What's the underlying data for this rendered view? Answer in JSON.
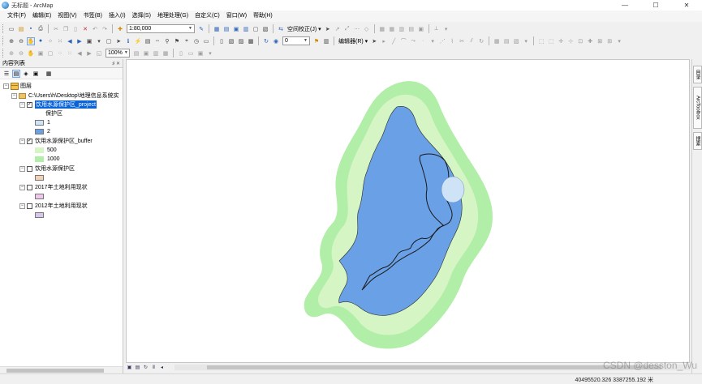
{
  "window": {
    "title": "无标题 - ArcMap",
    "minimize": "—",
    "maximize": "☐",
    "close": "✕"
  },
  "menu": [
    "文件(F)",
    "编辑(E)",
    "视图(V)",
    "书签(B)",
    "插入(I)",
    "选择(S)",
    "地理处理(G)",
    "自定义(C)",
    "窗口(W)",
    "帮助(H)"
  ],
  "toolbar": {
    "scale_value": "1:80,000",
    "georef_label": "空间校正(J) ▾",
    "editor_label": "编辑器(R) ▾",
    "angle_value": "0",
    "zoom_percent": "100%"
  },
  "toc": {
    "title": "内容列表",
    "pin": "♯ ✕",
    "root": "图层",
    "folder": "C:\\Users\\h\\Desktop\\地理信息系统实",
    "layers": [
      {
        "name": "饮用水源保护区_project",
        "checked": true,
        "selected": true,
        "field": "保护区",
        "classes": [
          {
            "label": "1",
            "color": "#cfe3f7"
          },
          {
            "label": "2",
            "color": "#6aa0e6"
          }
        ]
      },
      {
        "name": "饮用水源保护区_buffer",
        "checked": true,
        "classes": [
          {
            "label": "500",
            "color": "#d6f5c4"
          },
          {
            "label": "1000",
            "color": "#b1eea7"
          }
        ]
      },
      {
        "name": "饮用水源保护区",
        "checked": false,
        "symbol": "#f3d2b4"
      },
      {
        "name": "2017年土地利用现状",
        "checked": false,
        "symbol": "#efc6ec"
      },
      {
        "name": "2012年土地利用现状",
        "checked": false,
        "symbol": "#d8c6ea"
      }
    ]
  },
  "dock_tabs": [
    "目录",
    "ArcToolbox",
    "搜索"
  ],
  "status": {
    "coordinates": "40495520.326  3387255.192 米"
  },
  "watermark": "CSDN @desston_Wu",
  "colors": {
    "buffer_1000": "#b1eea7",
    "buffer_500": "#d6f5c4",
    "protect_2": "#6aa0e6",
    "protect_1": "#cfe3f7",
    "selection": "#0a64d8"
  }
}
